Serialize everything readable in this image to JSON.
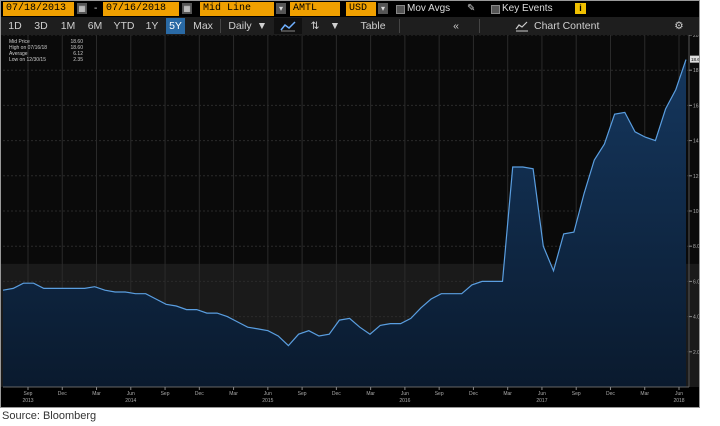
{
  "toolbar": {
    "start_date": "07/18/2013",
    "end_date": "07/16/2018",
    "dash": "-",
    "line_type": "Mid Line",
    "ticker": "AMTL",
    "currency": "USD",
    "mov_avgs": "Mov Avgs",
    "key_events": "Key Events",
    "info": "i",
    "periods": [
      "1D",
      "3D",
      "1M",
      "6M",
      "YTD",
      "1Y",
      "5Y",
      "Max"
    ],
    "selected_period": "5Y",
    "frequency": "Daily",
    "table_label": "Table",
    "collapse": "«",
    "chart_content": "Chart Content",
    "settings_icon": "gear-icon",
    "calendar_icon": "calendar-icon"
  },
  "legend": [
    {
      "label": "Mid Price",
      "value": "18.60"
    },
    {
      "label": "High on 07/16/18",
      "value": "18.60"
    },
    {
      "label": "Average",
      "value": "6.12"
    },
    {
      "label": "Low on 12/30/15",
      "value": "2.35"
    }
  ],
  "colors": {
    "accent_orange": "#f0a000",
    "selected_blue": "#2a6aa5",
    "area_fill": "#0f2a4a",
    "line": "#5a9ee0"
  },
  "chart_data": {
    "type": "area",
    "title": "",
    "ylim": [
      0,
      20
    ],
    "y_ticks": [
      "2.00",
      "4.00",
      "6.00",
      "8.00",
      "10.00",
      "12.00",
      "14.00",
      "16.00",
      "18.00",
      "20.00"
    ],
    "x_ticks": [
      "Sep",
      "Dec",
      "Mar",
      "Jun",
      "Sep",
      "Dec",
      "Mar",
      "Jun",
      "Sep",
      "Dec",
      "Mar",
      "Jun",
      "Sep",
      "Dec",
      "Mar",
      "Jun",
      "Sep",
      "Dec",
      "Mar",
      "Jun"
    ],
    "x_years": [
      "2013",
      "2014",
      "2015",
      "2016",
      "2017",
      "2018"
    ],
    "last_value_label": "18.60",
    "series": [
      {
        "values": [
          5.5,
          5.6,
          5.9,
          5.9,
          5.6,
          5.6,
          5.6,
          5.6,
          5.6,
          5.7,
          5.5,
          5.4,
          5.4,
          5.3,
          5.3,
          5.0,
          4.7,
          4.6,
          4.4,
          4.4,
          4.2,
          4.2,
          4.0,
          3.7,
          3.4,
          3.3,
          3.2,
          2.9,
          2.35,
          3.0,
          3.2,
          2.9,
          3.0,
          3.8,
          3.9,
          3.4,
          3.0,
          3.5,
          3.6,
          3.6,
          3.9,
          4.5,
          5.0,
          5.3,
          5.3,
          5.3,
          5.8,
          6.0,
          6.0,
          6.0,
          12.5,
          12.5,
          12.4,
          8.0,
          6.6,
          8.7,
          8.8,
          11.0,
          12.9,
          13.8,
          15.5,
          15.6,
          14.5,
          14.2,
          14.0,
          15.8,
          16.9,
          18.6
        ]
      }
    ]
  },
  "source": "Source: Bloomberg"
}
